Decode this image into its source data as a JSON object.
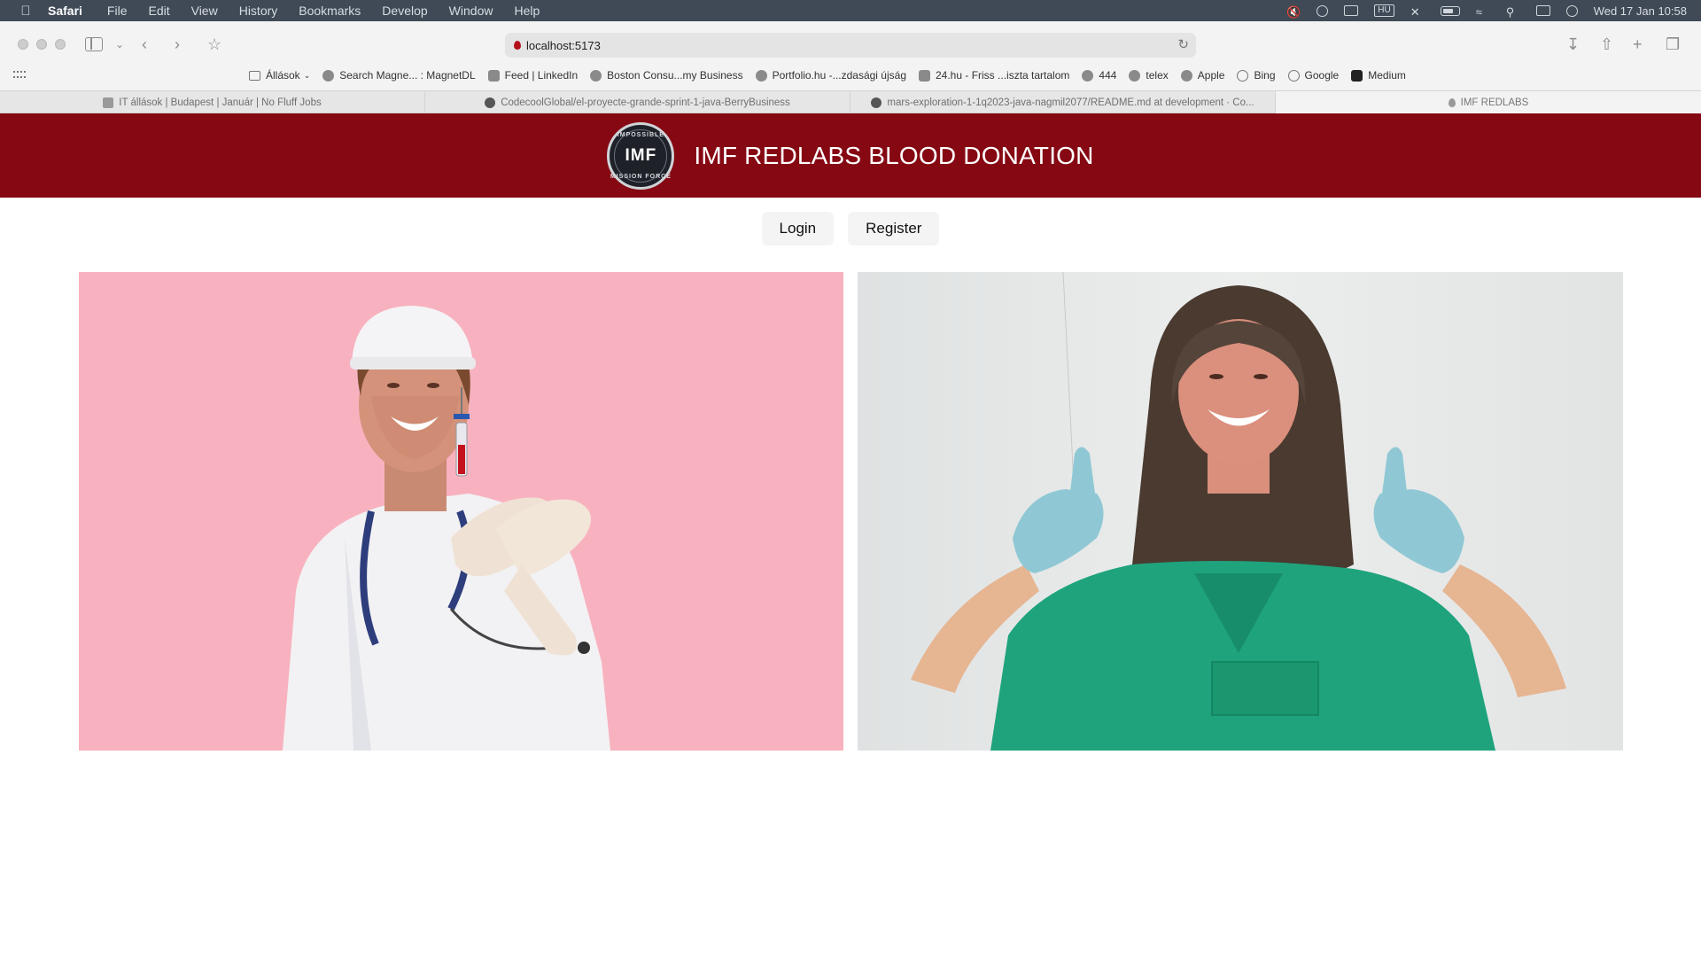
{
  "menubar": {
    "app": "Safari",
    "items": [
      "File",
      "Edit",
      "View",
      "History",
      "Bookmarks",
      "Develop",
      "Window",
      "Help"
    ],
    "input_source": "HU",
    "clock": "Wed 17 Jan  10:58"
  },
  "toolbar": {
    "url": "localhost:5173"
  },
  "bookmarks": [
    {
      "label": "Állások",
      "icon": "folder-icon"
    },
    {
      "label": "Search Magne... : MagnetDL",
      "icon": "magnet-icon"
    },
    {
      "label": "Feed | LinkedIn",
      "icon": "linkedin-icon"
    },
    {
      "label": "Boston Consu...my Business",
      "icon": "bcg-icon"
    },
    {
      "label": "Portfolio.hu -...zdasági újság",
      "icon": "portfolio-icon"
    },
    {
      "label": "24.hu - Friss ...iszta tartalom",
      "icon": "24hu-icon"
    },
    {
      "label": "444",
      "icon": "globe-icon"
    },
    {
      "label": "telex",
      "icon": "telex-icon"
    },
    {
      "label": "Apple",
      "icon": "apple-icon"
    },
    {
      "label": "Bing",
      "icon": "bing-icon"
    },
    {
      "label": "Google",
      "icon": "google-icon"
    },
    {
      "label": "Medium",
      "icon": "medium-icon"
    }
  ],
  "tabs": [
    {
      "label": "IT állások | Budapest | Január | No Fluff Jobs"
    },
    {
      "label": "CodecoolGlobal/el-proyecte-grande-sprint-1-java-BerryBusiness"
    },
    {
      "label": "mars-exploration-1-1q2023-java-nagmil2077/README.md at development · Co..."
    },
    {
      "label": "IMF REDLABS"
    }
  ],
  "site": {
    "logo_top": "IMPOSSIBLE",
    "logo_center": "IMF",
    "logo_bottom": "MISSION FORCE",
    "title": "IMF REDLABS BLOOD DONATION",
    "login_label": "Login",
    "register_label": "Register"
  },
  "colors": {
    "header_bg": "#850812",
    "accent_drop": "#b3101b",
    "left_photo_bg": "#f8b2bf"
  }
}
